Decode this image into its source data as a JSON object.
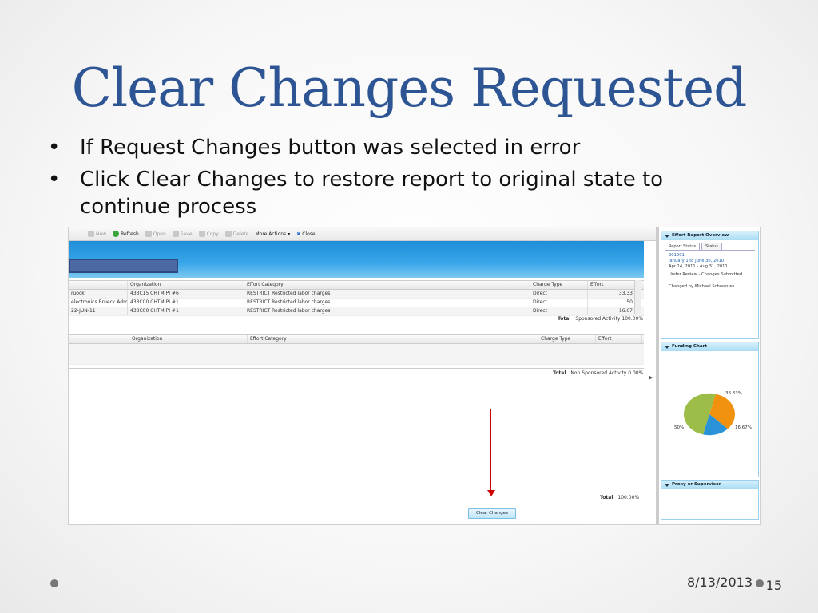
{
  "slide": {
    "title": "Clear Changes Requested",
    "bullets": [
      "If Request Changes button was selected in error",
      "Click Clear Changes to restore report to original  state to continue process"
    ],
    "date": "8/13/2013",
    "page_number": "15"
  },
  "toolbar": {
    "new_label": "New",
    "refresh_label": "Refresh",
    "open_label": "Open",
    "save_label": "Save",
    "copy_label": "Copy",
    "delete_label": "Delete",
    "more_actions_label": "More Actions",
    "close_label": "Close"
  },
  "sponsored_grid": {
    "columns": [
      "",
      "Organization",
      "Effort Category",
      "Charge Type",
      "Effort"
    ],
    "rows": [
      [
        "ruock",
        "433C15 CHTM PI #6",
        "RESTRICT Restricted labor charges",
        "Direct",
        "33.33"
      ],
      [
        "electronics Brueck Adm",
        "433C00 CHTM PI #1",
        "RESTRICT Restricted labor charges",
        "Direct",
        "50"
      ],
      [
        "22-JUN-11",
        "433C00 CHTM PI #1",
        "RESTRICT Restricted labor charges",
        "Direct",
        "16.67"
      ]
    ],
    "total_label": "Total",
    "total_value": "Sponsored Activity 100.00%"
  },
  "non_sponsored_grid": {
    "columns": [
      "",
      "Organization",
      "Effort Category",
      "Charge Type",
      "Effort"
    ],
    "total_label": "Total",
    "total_value": "Non Sponsored Activity 0.00%"
  },
  "grand_total": {
    "label": "Total",
    "value": "100.00%"
  },
  "clear_changes_button": "Clear Changes",
  "overview_panel": {
    "title": "Effort Report Overview",
    "tabs": [
      "Report Status",
      "Status"
    ],
    "report_id": "201001",
    "period": "January 1 to June 30, 2010",
    "dates": "Apr 14, 2011 - Aug 31, 2011",
    "status": "Under Review - Changes Submitted",
    "changed_by": "Changed by Michael Schwantes"
  },
  "funding_panel": {
    "title": "Funding Chart"
  },
  "proxy_panel": {
    "title": "Proxy or Supervisor"
  },
  "chart_data": {
    "type": "pie",
    "values": [
      33.33,
      16.67,
      50
    ],
    "labels": [
      "33.33%",
      "16.67%",
      "50%"
    ],
    "colors": [
      "#f0920f",
      "#2a93d8",
      "#9cbd48"
    ]
  }
}
